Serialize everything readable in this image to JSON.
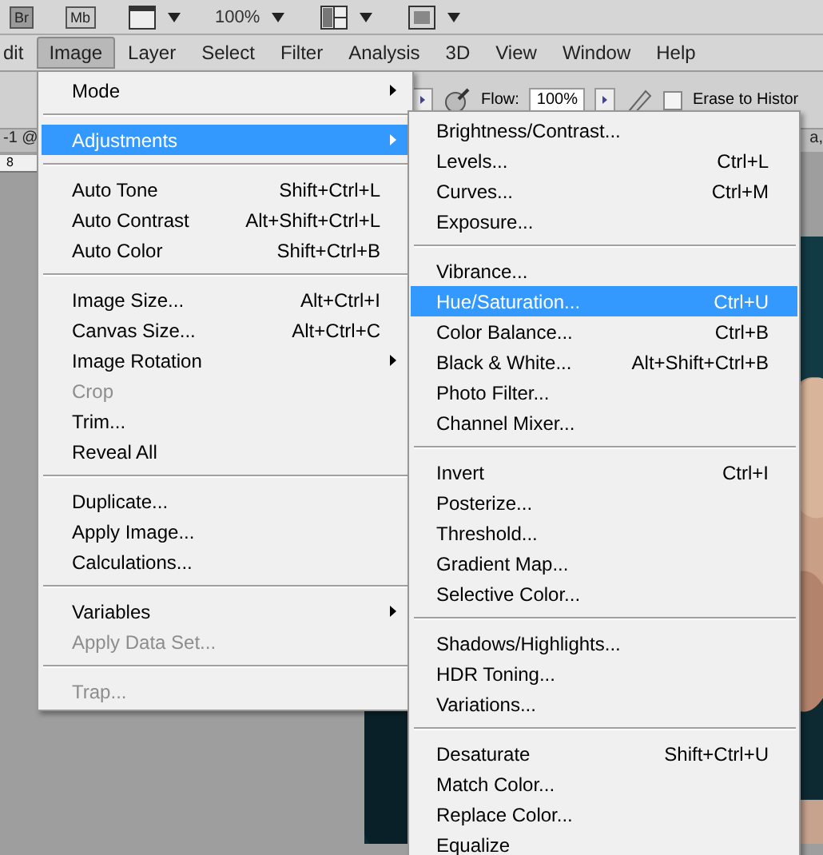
{
  "app_bar": {
    "bridge_label": "Br",
    "mini_bridge_label": "Mb",
    "zoom": "100%"
  },
  "menubar": [
    {
      "label": "dit",
      "selected": false
    },
    {
      "label": "Image",
      "selected": true
    },
    {
      "label": "Layer",
      "selected": false
    },
    {
      "label": "Select",
      "selected": false
    },
    {
      "label": "Filter",
      "selected": false
    },
    {
      "label": "Analysis",
      "selected": false
    },
    {
      "label": "3D",
      "selected": false
    },
    {
      "label": "View",
      "selected": false
    },
    {
      "label": "Window",
      "selected": false
    },
    {
      "label": "Help",
      "selected": false
    }
  ],
  "options_bar": {
    "flow_label": "Flow:",
    "flow_value": "100%",
    "erase_label": "Erase to Histor",
    "erase_checked": false
  },
  "document": {
    "tab_left": "-1 @",
    "tab_right": "a,",
    "ruler_mark": "8"
  },
  "image_menu": [
    {
      "kind": "item",
      "label": "Mode",
      "submenu": true,
      "disabled": false,
      "selected": false
    },
    {
      "kind": "separator"
    },
    {
      "kind": "item",
      "label": "Adjustments",
      "submenu": true,
      "disabled": false,
      "selected": true
    },
    {
      "kind": "separator"
    },
    {
      "kind": "item",
      "label": "Auto Tone",
      "shortcut": "Shift+Ctrl+L",
      "submenu": false,
      "disabled": false,
      "selected": false
    },
    {
      "kind": "item",
      "label": "Auto Contrast",
      "shortcut": "Alt+Shift+Ctrl+L",
      "submenu": false,
      "disabled": false,
      "selected": false
    },
    {
      "kind": "item",
      "label": "Auto Color",
      "shortcut": "Shift+Ctrl+B",
      "submenu": false,
      "disabled": false,
      "selected": false
    },
    {
      "kind": "separator"
    },
    {
      "kind": "item",
      "label": "Image Size...",
      "shortcut": "Alt+Ctrl+I",
      "submenu": false,
      "disabled": false,
      "selected": false
    },
    {
      "kind": "item",
      "label": "Canvas Size...",
      "shortcut": "Alt+Ctrl+C",
      "submenu": false,
      "disabled": false,
      "selected": false
    },
    {
      "kind": "item",
      "label": "Image Rotation",
      "submenu": true,
      "disabled": false,
      "selected": false
    },
    {
      "kind": "item",
      "label": "Crop",
      "submenu": false,
      "disabled": true,
      "selected": false
    },
    {
      "kind": "item",
      "label": "Trim...",
      "submenu": false,
      "disabled": false,
      "selected": false
    },
    {
      "kind": "item",
      "label": "Reveal All",
      "submenu": false,
      "disabled": false,
      "selected": false
    },
    {
      "kind": "separator"
    },
    {
      "kind": "item",
      "label": "Duplicate...",
      "submenu": false,
      "disabled": false,
      "selected": false
    },
    {
      "kind": "item",
      "label": "Apply Image...",
      "submenu": false,
      "disabled": false,
      "selected": false
    },
    {
      "kind": "item",
      "label": "Calculations...",
      "submenu": false,
      "disabled": false,
      "selected": false
    },
    {
      "kind": "separator"
    },
    {
      "kind": "item",
      "label": "Variables",
      "submenu": true,
      "disabled": false,
      "selected": false
    },
    {
      "kind": "item",
      "label": "Apply Data Set...",
      "submenu": false,
      "disabled": true,
      "selected": false
    },
    {
      "kind": "separator"
    },
    {
      "kind": "item",
      "label": "Trap...",
      "submenu": false,
      "disabled": true,
      "selected": false
    }
  ],
  "adjustments_menu": [
    {
      "kind": "item",
      "label": "Brightness/Contrast...",
      "selected": false
    },
    {
      "kind": "item",
      "label": "Levels...",
      "shortcut": "Ctrl+L",
      "selected": false
    },
    {
      "kind": "item",
      "label": "Curves...",
      "shortcut": "Ctrl+M",
      "selected": false
    },
    {
      "kind": "item",
      "label": "Exposure...",
      "selected": false
    },
    {
      "kind": "separator"
    },
    {
      "kind": "item",
      "label": "Vibrance...",
      "selected": false
    },
    {
      "kind": "item",
      "label": "Hue/Saturation...",
      "shortcut": "Ctrl+U",
      "selected": true
    },
    {
      "kind": "item",
      "label": "Color Balance...",
      "shortcut": "Ctrl+B",
      "selected": false
    },
    {
      "kind": "item",
      "label": "Black & White...",
      "shortcut": "Alt+Shift+Ctrl+B",
      "selected": false
    },
    {
      "kind": "item",
      "label": "Photo Filter...",
      "selected": false
    },
    {
      "kind": "item",
      "label": "Channel Mixer...",
      "selected": false
    },
    {
      "kind": "separator"
    },
    {
      "kind": "item",
      "label": "Invert",
      "shortcut": "Ctrl+I",
      "selected": false
    },
    {
      "kind": "item",
      "label": "Posterize...",
      "selected": false
    },
    {
      "kind": "item",
      "label": "Threshold...",
      "selected": false
    },
    {
      "kind": "item",
      "label": "Gradient Map...",
      "selected": false
    },
    {
      "kind": "item",
      "label": "Selective Color...",
      "selected": false
    },
    {
      "kind": "separator"
    },
    {
      "kind": "item",
      "label": "Shadows/Highlights...",
      "selected": false
    },
    {
      "kind": "item",
      "label": "HDR Toning...",
      "selected": false
    },
    {
      "kind": "item",
      "label": "Variations...",
      "selected": false
    },
    {
      "kind": "separator"
    },
    {
      "kind": "item",
      "label": "Desaturate",
      "shortcut": "Shift+Ctrl+U",
      "selected": false
    },
    {
      "kind": "item",
      "label": "Match Color...",
      "selected": false
    },
    {
      "kind": "item",
      "label": "Replace Color...",
      "selected": false
    },
    {
      "kind": "item",
      "label": "Equalize",
      "selected": false
    }
  ]
}
